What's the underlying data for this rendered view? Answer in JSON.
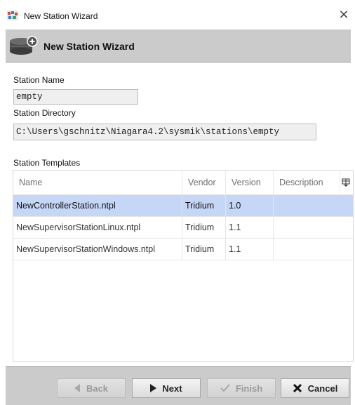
{
  "window": {
    "title": "New Station Wizard",
    "close_glyph": "×"
  },
  "header": {
    "title": "New Station Wizard",
    "icon": "station-database-icon"
  },
  "form": {
    "station_name_label": "Station Name",
    "station_name_value": "empty",
    "station_directory_label": "Station Directory",
    "station_directory_value": "C:\\Users\\gschnitz\\Niagara4.2\\sysmik\\stations\\empty"
  },
  "templates": {
    "label": "Station Templates",
    "columns": [
      "Name",
      "Vendor",
      "Version",
      "Description"
    ],
    "rows": [
      {
        "name": "NewControllerStation.ntpl",
        "vendor": "Tridium",
        "version": "1.0",
        "description": "",
        "selected": true
      },
      {
        "name": "NewSupervisorStationLinux.ntpl",
        "vendor": "Tridium",
        "version": "1.1",
        "description": "",
        "selected": false
      },
      {
        "name": "NewSupervisorStationWindows.ntpl",
        "vendor": "Tridium",
        "version": "1.1",
        "description": "",
        "selected": false
      }
    ],
    "selection_color": "#c6d6f7"
  },
  "buttons": {
    "back": {
      "label": "Back",
      "enabled": false,
      "icon": "arrow-left-icon"
    },
    "next": {
      "label": "Next",
      "enabled": true,
      "icon": "arrow-right-icon"
    },
    "finish": {
      "label": "Finish",
      "enabled": false,
      "icon": "checkmark-icon"
    },
    "cancel": {
      "label": "Cancel",
      "enabled": true,
      "icon": "x-icon"
    }
  }
}
